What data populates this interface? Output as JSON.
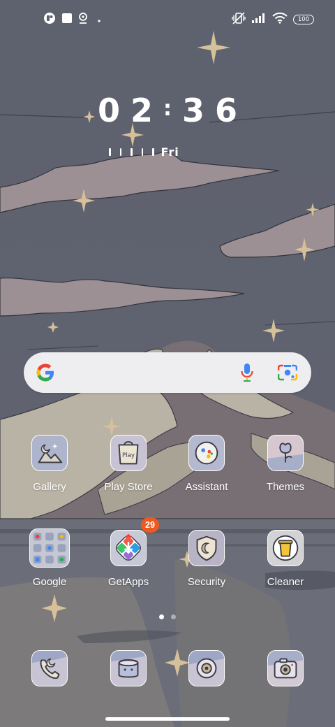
{
  "status_bar": {
    "icons_left": [
      "app-notification-icon",
      "square-notification-icon",
      "location-pin-icon",
      "more-dot-icon"
    ],
    "icons_right": [
      "vibrate-off-icon",
      "signal-icon",
      "wifi-icon"
    ],
    "battery": "100"
  },
  "clock": {
    "h1": "0",
    "h2": "2",
    "separator": ":",
    "m1": "3",
    "m2": "6",
    "weekday": "Fri"
  },
  "search": {
    "icons": [
      "google-logo-icon",
      "microphone-icon",
      "google-lens-icon"
    ]
  },
  "apps": [
    {
      "label": "Gallery",
      "icon": "gallery-icon"
    },
    {
      "label": "Play Store",
      "icon": "play-store-icon"
    },
    {
      "label": "Assistant",
      "icon": "assistant-icon"
    },
    {
      "label": "Themes",
      "icon": "themes-icon"
    },
    {
      "label": "Google",
      "icon": "google-folder-icon"
    },
    {
      "label": "GetApps",
      "icon": "getapps-icon",
      "badge": "29"
    },
    {
      "label": "Security",
      "icon": "security-icon"
    },
    {
      "label": "Cleaner",
      "icon": "cleaner-icon"
    }
  ],
  "dock": [
    {
      "icon": "phone-icon"
    },
    {
      "icon": "messages-icon"
    },
    {
      "icon": "browser-icon"
    },
    {
      "icon": "camera-icon"
    }
  ],
  "page_indicator": {
    "pages": 2,
    "current": 1
  },
  "colors": {
    "badge": "#ec5a22",
    "sky": "#5d606d",
    "cloud": "#9c8f94",
    "mountain_light": "#b8b3a6"
  }
}
